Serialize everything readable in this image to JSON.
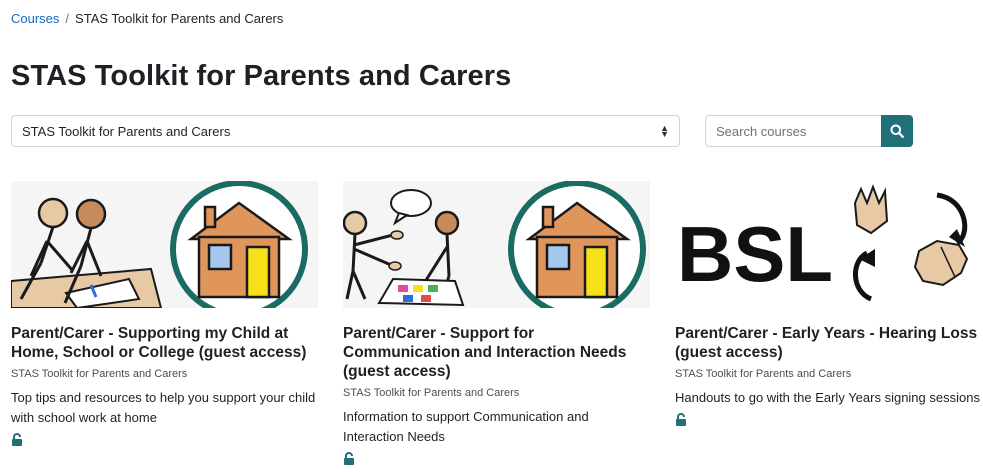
{
  "breadcrumb": {
    "items": [
      "Courses",
      "STAS Toolkit for Parents and Carers"
    ],
    "separator": "/"
  },
  "page_title": "STAS Toolkit for Parents and Carers",
  "category_select": {
    "selected": "STAS Toolkit for Parents and Carers"
  },
  "search": {
    "placeholder": "Search courses",
    "icon": "search-icon"
  },
  "courses": [
    {
      "name": "Parent/Carer - Supporting my Child at Home, School or College (guest access)",
      "category": "STAS Toolkit for Parents and Carers",
      "summary": "Top tips and resources to help you support your child with school work at home",
      "icon": "unlock-icon",
      "image": "people-writing-and-house-symbol"
    },
    {
      "name": "Parent/Carer - Support for Communication and Interaction Needs (guest access)",
      "category": "STAS Toolkit for Parents and Carers",
      "summary": "Information to support Communication and Interaction Needs",
      "icon": "unlock-icon",
      "image": "people-communicating-and-house-symbol"
    },
    {
      "name": "Parent/Carer - Early Years - Hearing Loss (guest access)",
      "category": "STAS Toolkit for Parents and Carers",
      "summary": "Handouts to go with the Early Years signing sessions",
      "icon": "unlock-icon",
      "image": "bsl-signing-hands",
      "image_text": "BSL"
    }
  ],
  "colors": {
    "link": "#0f6cbf",
    "accent": "#1f7079",
    "text": "#1d2125",
    "house_body": "#e0955a",
    "house_window": "#a5c8ee",
    "house_door": "#f7e018",
    "circle": "#1a6b62"
  }
}
